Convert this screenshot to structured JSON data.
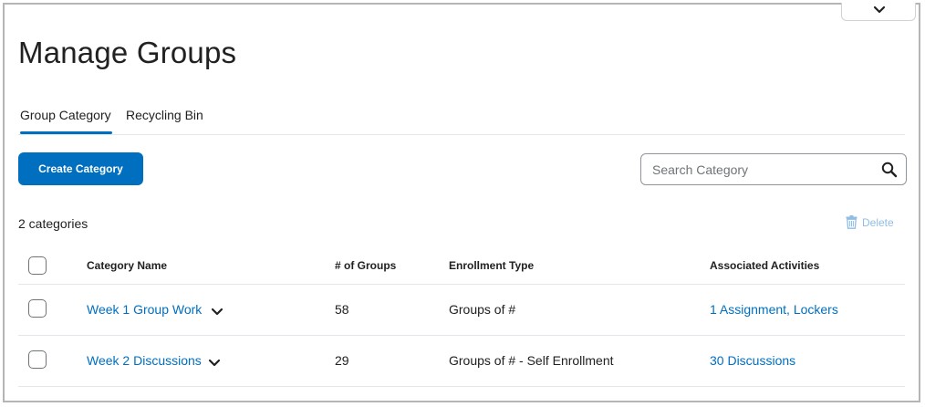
{
  "page": {
    "title": "Manage Groups"
  },
  "tabs": [
    {
      "label": "Group Category",
      "active": true
    },
    {
      "label": "Recycling Bin",
      "active": false
    }
  ],
  "toolbar": {
    "create_label": "Create Category",
    "search_placeholder": "Search Category",
    "search_value": ""
  },
  "summary": {
    "count_text": "2 categories",
    "delete_label": "Delete"
  },
  "table": {
    "columns": [
      "Category Name",
      "# of Groups",
      "Enrollment Type",
      "Associated Activities"
    ],
    "rows": [
      {
        "name": "Week 1 Group Work",
        "groups": "58",
        "enrollment": "Groups of #",
        "activities": "1 Assignment, Lockers"
      },
      {
        "name": "Week 2 Discussions",
        "groups": "29",
        "enrollment": "Groups of # - Self Enrollment",
        "activities": "30 Discussions"
      }
    ]
  },
  "colors": {
    "primary": "#006fbf",
    "delete_disabled": "#8fbde6",
    "border": "#e3e6ea"
  },
  "icons": {
    "top": "chevron-down-icon",
    "search": "search-icon",
    "delete": "trash-icon",
    "row_menu": "chevron-down-icon"
  }
}
